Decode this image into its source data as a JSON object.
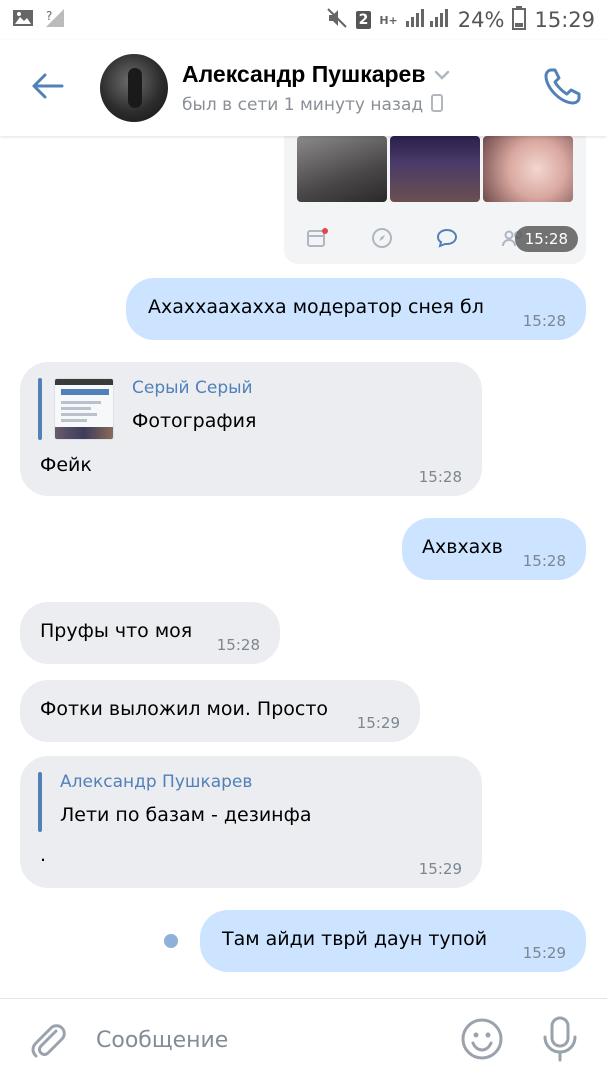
{
  "status_bar": {
    "sim_badge": "2",
    "network": "H+",
    "battery": "24%",
    "time": "15:29"
  },
  "header": {
    "name": "Александр Пушкарев",
    "status": "был в сети 1 минуту назад"
  },
  "shared_card": {
    "time": "15:28"
  },
  "messages": [
    {
      "dir": "out",
      "text": "Ахаххаахахха модератор снея бл",
      "time": "15:28"
    },
    {
      "dir": "in",
      "reply_author": "Серый Серый",
      "reply_text": "Фотография",
      "text": "Фейк",
      "time": "15:28"
    },
    {
      "dir": "out",
      "text": "Ахвхахв",
      "time": "15:28"
    },
    {
      "dir": "in",
      "text": "Пруфы что моя",
      "time": "15:28"
    },
    {
      "dir": "in",
      "text": "Фотки выложил мои. Просто",
      "time": "15:29"
    },
    {
      "dir": "in",
      "reply_author": "Александр Пушкарев",
      "reply_text": "Лети по базам - дезинфа",
      "text": ".",
      "time": "15:29"
    },
    {
      "dir": "out",
      "text": "Там айди тврй даун тупой",
      "time": "15:29",
      "unread": true
    }
  ],
  "composer": {
    "placeholder": "Сообщение"
  },
  "colors": {
    "accent": "#5181b8",
    "outgoing_bubble": "#cce4ff",
    "incoming_bubble": "#ebedf0",
    "time_text": "#7d8690"
  },
  "icons": [
    "back-arrow-icon",
    "chevron-down-icon",
    "phone-icon",
    "paperclip-icon",
    "smile-icon",
    "microphone-icon"
  ]
}
